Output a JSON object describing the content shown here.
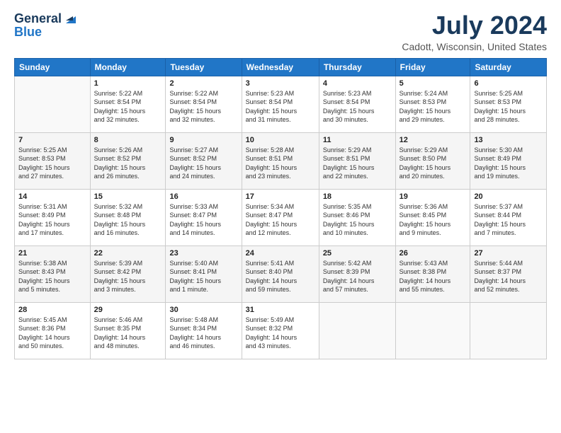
{
  "header": {
    "logo_line1": "General",
    "logo_line2": "Blue",
    "month_title": "July 2024",
    "location": "Cadott, Wisconsin, United States"
  },
  "weekdays": [
    "Sunday",
    "Monday",
    "Tuesday",
    "Wednesday",
    "Thursday",
    "Friday",
    "Saturday"
  ],
  "weeks": [
    [
      {
        "day": "",
        "info": ""
      },
      {
        "day": "1",
        "info": "Sunrise: 5:22 AM\nSunset: 8:54 PM\nDaylight: 15 hours\nand 32 minutes."
      },
      {
        "day": "2",
        "info": "Sunrise: 5:22 AM\nSunset: 8:54 PM\nDaylight: 15 hours\nand 32 minutes."
      },
      {
        "day": "3",
        "info": "Sunrise: 5:23 AM\nSunset: 8:54 PM\nDaylight: 15 hours\nand 31 minutes."
      },
      {
        "day": "4",
        "info": "Sunrise: 5:23 AM\nSunset: 8:54 PM\nDaylight: 15 hours\nand 30 minutes."
      },
      {
        "day": "5",
        "info": "Sunrise: 5:24 AM\nSunset: 8:53 PM\nDaylight: 15 hours\nand 29 minutes."
      },
      {
        "day": "6",
        "info": "Sunrise: 5:25 AM\nSunset: 8:53 PM\nDaylight: 15 hours\nand 28 minutes."
      }
    ],
    [
      {
        "day": "7",
        "info": "Sunrise: 5:25 AM\nSunset: 8:53 PM\nDaylight: 15 hours\nand 27 minutes."
      },
      {
        "day": "8",
        "info": "Sunrise: 5:26 AM\nSunset: 8:52 PM\nDaylight: 15 hours\nand 26 minutes."
      },
      {
        "day": "9",
        "info": "Sunrise: 5:27 AM\nSunset: 8:52 PM\nDaylight: 15 hours\nand 24 minutes."
      },
      {
        "day": "10",
        "info": "Sunrise: 5:28 AM\nSunset: 8:51 PM\nDaylight: 15 hours\nand 23 minutes."
      },
      {
        "day": "11",
        "info": "Sunrise: 5:29 AM\nSunset: 8:51 PM\nDaylight: 15 hours\nand 22 minutes."
      },
      {
        "day": "12",
        "info": "Sunrise: 5:29 AM\nSunset: 8:50 PM\nDaylight: 15 hours\nand 20 minutes."
      },
      {
        "day": "13",
        "info": "Sunrise: 5:30 AM\nSunset: 8:49 PM\nDaylight: 15 hours\nand 19 minutes."
      }
    ],
    [
      {
        "day": "14",
        "info": "Sunrise: 5:31 AM\nSunset: 8:49 PM\nDaylight: 15 hours\nand 17 minutes."
      },
      {
        "day": "15",
        "info": "Sunrise: 5:32 AM\nSunset: 8:48 PM\nDaylight: 15 hours\nand 16 minutes."
      },
      {
        "day": "16",
        "info": "Sunrise: 5:33 AM\nSunset: 8:47 PM\nDaylight: 15 hours\nand 14 minutes."
      },
      {
        "day": "17",
        "info": "Sunrise: 5:34 AM\nSunset: 8:47 PM\nDaylight: 15 hours\nand 12 minutes."
      },
      {
        "day": "18",
        "info": "Sunrise: 5:35 AM\nSunset: 8:46 PM\nDaylight: 15 hours\nand 10 minutes."
      },
      {
        "day": "19",
        "info": "Sunrise: 5:36 AM\nSunset: 8:45 PM\nDaylight: 15 hours\nand 9 minutes."
      },
      {
        "day": "20",
        "info": "Sunrise: 5:37 AM\nSunset: 8:44 PM\nDaylight: 15 hours\nand 7 minutes."
      }
    ],
    [
      {
        "day": "21",
        "info": "Sunrise: 5:38 AM\nSunset: 8:43 PM\nDaylight: 15 hours\nand 5 minutes."
      },
      {
        "day": "22",
        "info": "Sunrise: 5:39 AM\nSunset: 8:42 PM\nDaylight: 15 hours\nand 3 minutes."
      },
      {
        "day": "23",
        "info": "Sunrise: 5:40 AM\nSunset: 8:41 PM\nDaylight: 15 hours\nand 1 minute."
      },
      {
        "day": "24",
        "info": "Sunrise: 5:41 AM\nSunset: 8:40 PM\nDaylight: 14 hours\nand 59 minutes."
      },
      {
        "day": "25",
        "info": "Sunrise: 5:42 AM\nSunset: 8:39 PM\nDaylight: 14 hours\nand 57 minutes."
      },
      {
        "day": "26",
        "info": "Sunrise: 5:43 AM\nSunset: 8:38 PM\nDaylight: 14 hours\nand 55 minutes."
      },
      {
        "day": "27",
        "info": "Sunrise: 5:44 AM\nSunset: 8:37 PM\nDaylight: 14 hours\nand 52 minutes."
      }
    ],
    [
      {
        "day": "28",
        "info": "Sunrise: 5:45 AM\nSunset: 8:36 PM\nDaylight: 14 hours\nand 50 minutes."
      },
      {
        "day": "29",
        "info": "Sunrise: 5:46 AM\nSunset: 8:35 PM\nDaylight: 14 hours\nand 48 minutes."
      },
      {
        "day": "30",
        "info": "Sunrise: 5:48 AM\nSunset: 8:34 PM\nDaylight: 14 hours\nand 46 minutes."
      },
      {
        "day": "31",
        "info": "Sunrise: 5:49 AM\nSunset: 8:32 PM\nDaylight: 14 hours\nand 43 minutes."
      },
      {
        "day": "",
        "info": ""
      },
      {
        "day": "",
        "info": ""
      },
      {
        "day": "",
        "info": ""
      }
    ]
  ]
}
